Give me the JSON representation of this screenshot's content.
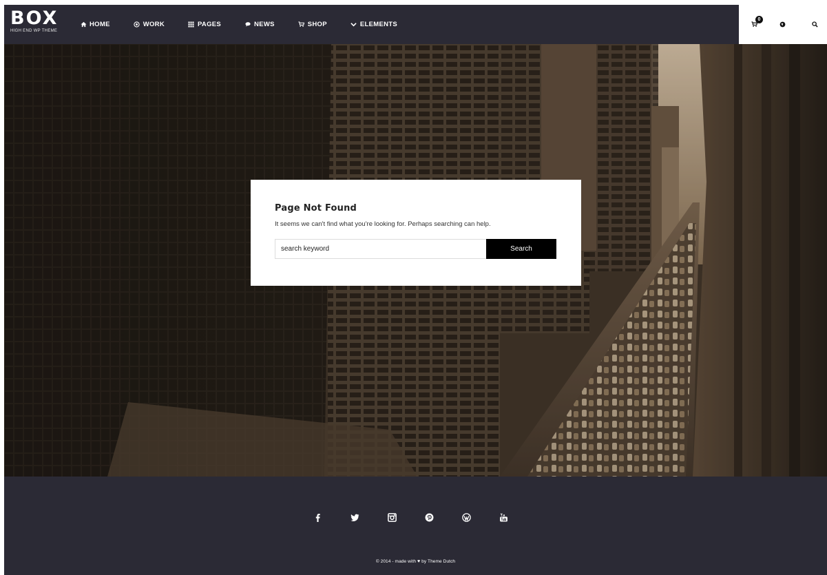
{
  "header": {
    "logo": {
      "main": "BOX",
      "sub": "HIGH END WP THEME"
    },
    "nav": [
      {
        "label": "HOME",
        "icon": "home-icon"
      },
      {
        "label": "WORK",
        "icon": "target-icon"
      },
      {
        "label": "PAGES",
        "icon": "grid-icon"
      },
      {
        "label": "NEWS",
        "icon": "chat-icon"
      },
      {
        "label": "SHOP",
        "icon": "cart-icon"
      },
      {
        "label": "ELEMENTS",
        "icon": "chevron-down-icon"
      }
    ],
    "cart_count": "0",
    "right_icons": [
      "cart-icon",
      "globe-icon",
      "search-icon"
    ]
  },
  "notfound": {
    "title": "Page Not Found",
    "message": "It seems we can't find what you're looking for. Perhaps searching can help.",
    "search_placeholder": "search keyword",
    "search_button": "Search"
  },
  "footer": {
    "social": [
      "facebook-icon",
      "twitter-icon",
      "instagram-icon",
      "pinterest-icon",
      "wordpress-icon",
      "youtube-icon"
    ],
    "copyright_prefix": "© 2014 - made with",
    "copyright_suffix": "by Theme Dutch"
  },
  "colors": {
    "header_bg": "#2b2a35",
    "footer_bg": "#2b2a35",
    "button_bg": "#000000",
    "text_light": "#ffffff"
  }
}
